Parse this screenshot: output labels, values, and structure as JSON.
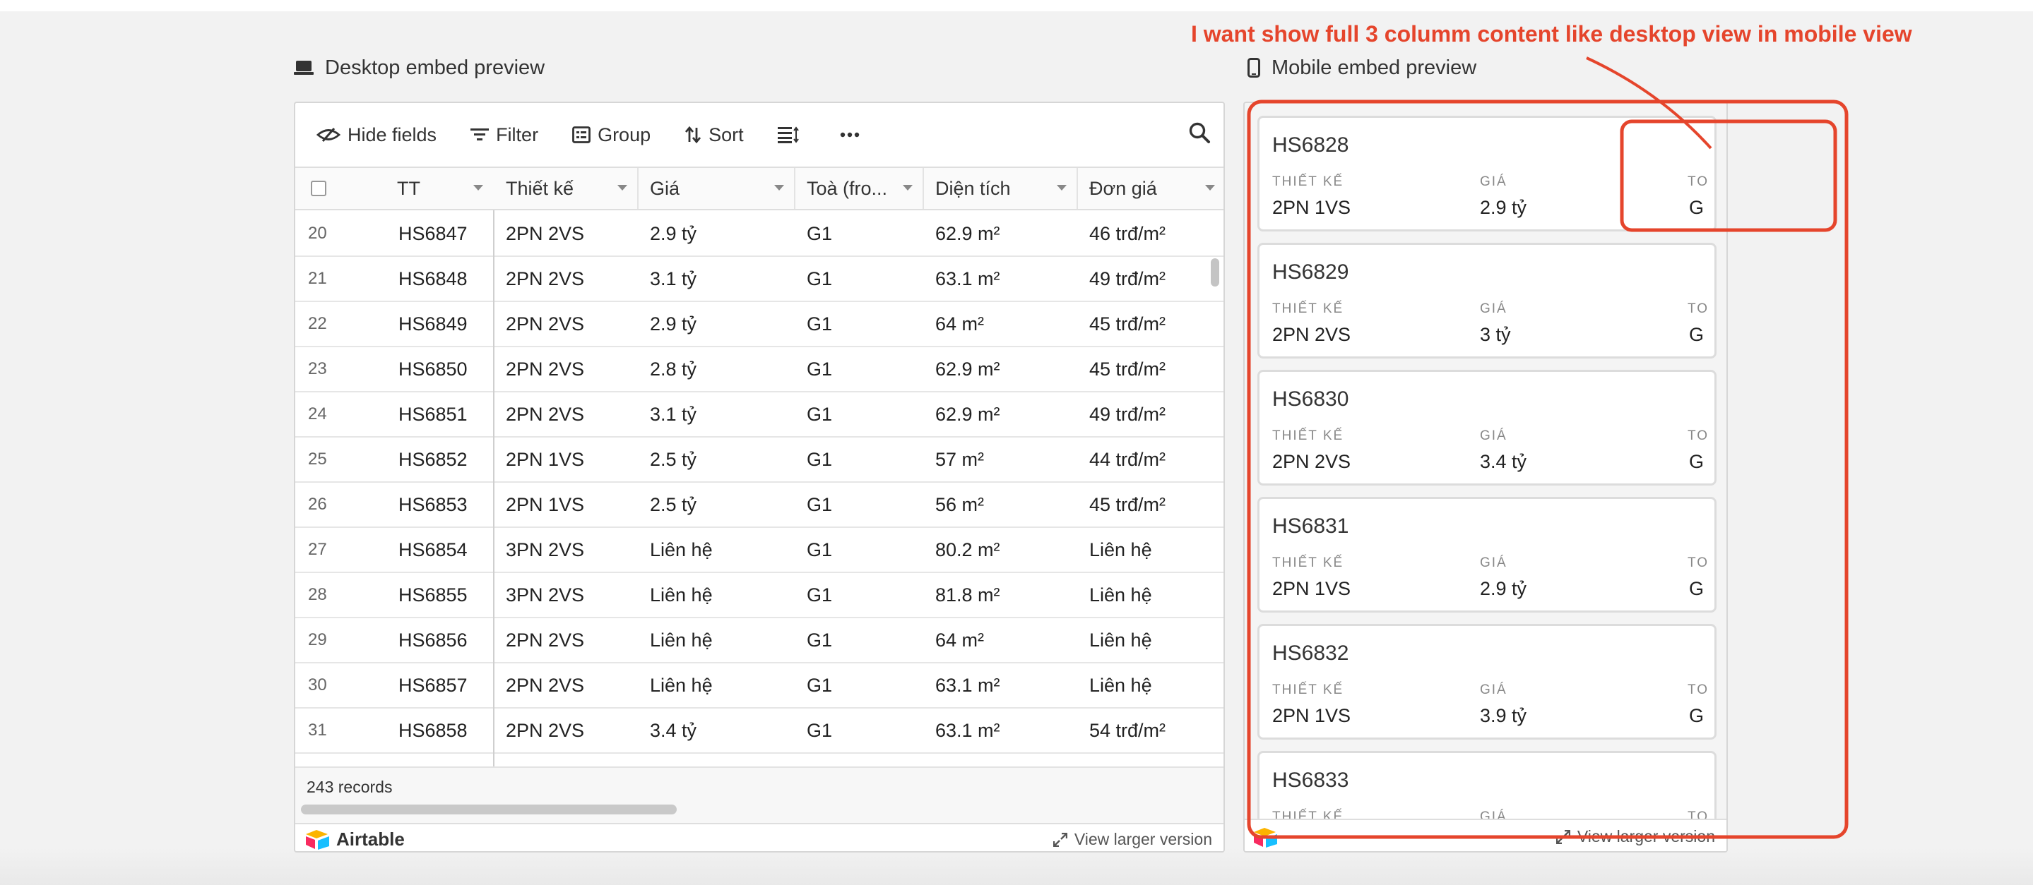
{
  "annotation": {
    "text": "I want show full 3 columm content like desktop view in mobile view"
  },
  "desktop": {
    "section_title": "Desktop embed preview",
    "toolbar": {
      "hide_fields": "Hide fields",
      "filter": "Filter",
      "group": "Group",
      "sort": "Sort"
    },
    "columns": [
      "TT",
      "Thiết kế",
      "Giá",
      "Toà (fro...",
      "Diện tích",
      "Đơn giá"
    ],
    "rows": [
      {
        "num": "20",
        "tt": "HS6847",
        "thiet_ke": "2PN 2VS",
        "gia": "2.9 tỷ",
        "toa": "G1",
        "dien_tich": "62.9 m²",
        "don_gia": "46 trđ/m²"
      },
      {
        "num": "21",
        "tt": "HS6848",
        "thiet_ke": "2PN 2VS",
        "gia": "3.1 tỷ",
        "toa": "G1",
        "dien_tich": "63.1 m²",
        "don_gia": "49 trđ/m²"
      },
      {
        "num": "22",
        "tt": "HS6849",
        "thiet_ke": "2PN 2VS",
        "gia": "2.9 tỷ",
        "toa": "G1",
        "dien_tich": "64 m²",
        "don_gia": "45 trđ/m²"
      },
      {
        "num": "23",
        "tt": "HS6850",
        "thiet_ke": "2PN 2VS",
        "gia": "2.8 tỷ",
        "toa": "G1",
        "dien_tich": "62.9 m²",
        "don_gia": "45 trđ/m²"
      },
      {
        "num": "24",
        "tt": "HS6851",
        "thiet_ke": "2PN 2VS",
        "gia": "3.1 tỷ",
        "toa": "G1",
        "dien_tich": "62.9 m²",
        "don_gia": "49 trđ/m²"
      },
      {
        "num": "25",
        "tt": "HS6852",
        "thiet_ke": "2PN 1VS",
        "gia": "2.5 tỷ",
        "toa": "G1",
        "dien_tich": "57 m²",
        "don_gia": "44 trđ/m²"
      },
      {
        "num": "26",
        "tt": "HS6853",
        "thiet_ke": "2PN 1VS",
        "gia": "2.5 tỷ",
        "toa": "G1",
        "dien_tich": "56 m²",
        "don_gia": "45 trđ/m²"
      },
      {
        "num": "27",
        "tt": "HS6854",
        "thiet_ke": "3PN 2VS",
        "gia": "Liên hệ",
        "toa": "G1",
        "dien_tich": "80.2 m²",
        "don_gia": "Liên hệ"
      },
      {
        "num": "28",
        "tt": "HS6855",
        "thiet_ke": "3PN 2VS",
        "gia": "Liên hệ",
        "toa": "G1",
        "dien_tich": "81.8 m²",
        "don_gia": "Liên hệ"
      },
      {
        "num": "29",
        "tt": "HS6856",
        "thiet_ke": "2PN 2VS",
        "gia": "Liên hệ",
        "toa": "G1",
        "dien_tich": "64 m²",
        "don_gia": "Liên hệ"
      },
      {
        "num": "30",
        "tt": "HS6857",
        "thiet_ke": "2PN 2VS",
        "gia": "Liên hệ",
        "toa": "G1",
        "dien_tich": "63.1 m²",
        "don_gia": "Liên hệ"
      },
      {
        "num": "31",
        "tt": "HS6858",
        "thiet_ke": "2PN 2VS",
        "gia": "3.4 tỷ",
        "toa": "G1",
        "dien_tich": "63.1 m²",
        "don_gia": "54 trđ/m²"
      }
    ],
    "records": "243 records",
    "brand": "Airtable",
    "view_larger": "View larger version"
  },
  "mobile": {
    "section_title": "Mobile embed preview",
    "label_thiet_ke": "THIẾT KẾ",
    "label_gia": "GIÁ",
    "label_toa": "TO",
    "cards": [
      {
        "title": "HS6828",
        "thiet_ke": "2PN 1VS",
        "gia": "2.9 tỷ",
        "toa": "G"
      },
      {
        "title": "HS6829",
        "thiet_ke": "2PN 2VS",
        "gia": "3 tỷ",
        "toa": "G"
      },
      {
        "title": "HS6830",
        "thiet_ke": "2PN 2VS",
        "gia": "3.4 tỷ",
        "toa": "G"
      },
      {
        "title": "HS6831",
        "thiet_ke": "2PN 1VS",
        "gia": "2.9 tỷ",
        "toa": "G"
      },
      {
        "title": "HS6832",
        "thiet_ke": "2PN 1VS",
        "gia": "3.9 tỷ",
        "toa": "G"
      },
      {
        "title": "HS6833",
        "thiet_ke": "",
        "gia": "",
        "toa": ""
      }
    ],
    "view_larger": "View larger version"
  },
  "colors": {
    "annotation": "#e5452c",
    "brand_red": "#f82b60",
    "brand_yellow": "#fcb400",
    "brand_blue": "#18bfff"
  }
}
